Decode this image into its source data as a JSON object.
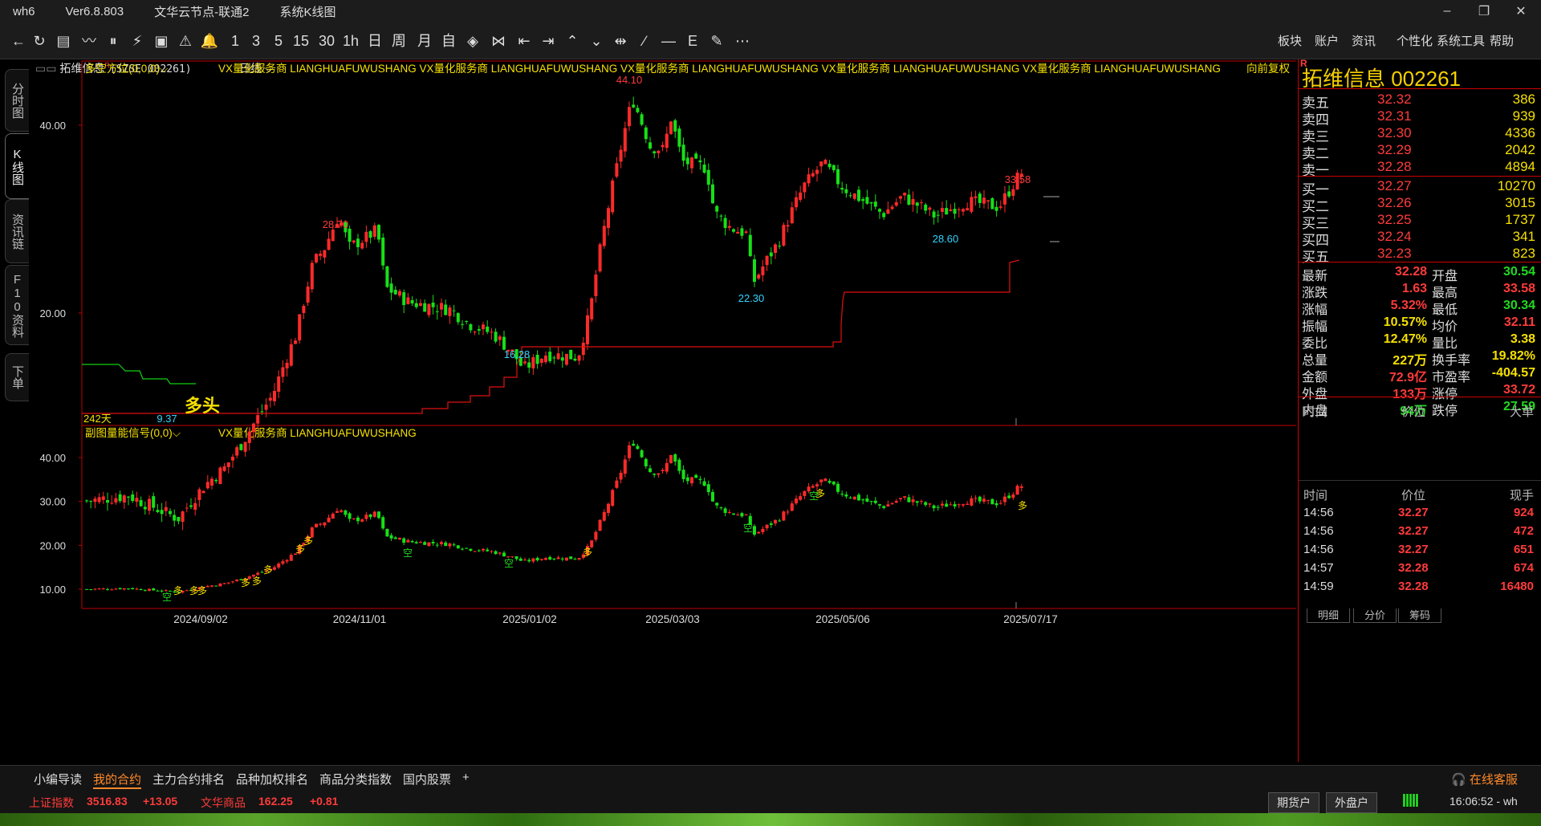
{
  "window": {
    "app": "wh6",
    "version": "Ver6.8.803",
    "server": "文华云节点-联通2",
    "view": "系统K线图",
    "min": "–",
    "restore": "❐",
    "close": "✕"
  },
  "toolbar": {
    "buttons": [
      "←",
      "↻",
      "▤",
      "〰",
      "⏸",
      "⚡",
      "▣",
      "⚠",
      "🔔",
      "1",
      "3",
      "5",
      "15",
      "30",
      "1h",
      "日",
      "周",
      "月",
      "自",
      "◈",
      "⋈",
      "⇤",
      "⇥",
      "⌃",
      "⌄",
      "⇹",
      "∕",
      "—",
      "E",
      "✎",
      "⋯"
    ],
    "menus": [
      "板块",
      "账户",
      "资讯",
      "个性化",
      "系统工具",
      "帮助"
    ]
  },
  "left_tabs": [
    {
      "label": "分时图",
      "active": false
    },
    {
      "label": "K线图",
      "active": true
    },
    {
      "label": "资讯链",
      "active": false
    },
    {
      "label": "F10资料",
      "active": false
    },
    {
      "label": "下单",
      "active": false
    }
  ],
  "chart_header": {
    "stock": "拓维信息",
    "superscript": "R",
    "code": "(SZSE 002261)",
    "period": "日线"
  },
  "main_panel": {
    "indicator_label": "多空方位(0,0,0)",
    "dropdown": "⌵",
    "watermark": "VX量化服务商  LIANGHUAFUWUSHANG  VX量化服务商  LIANGHUAFUWUSHANG  VX量化服务商  LIANGHUAFUWUSHANG  VX量化服务商  LIANGHUAFUWUSHANG  VX量化服务商  LIANGHUAFUWUSHANG",
    "adjust": "向前复权",
    "y_ticks": [
      "40.00",
      "20.00"
    ],
    "marks": {
      "high": "44.10",
      "peak1": "28.70",
      "recent_high": "33.58",
      "low1": "9.37",
      "low2": "16.28",
      "low3": "22.30",
      "low4": "28.60",
      "days": "242天",
      "signal": "多头"
    }
  },
  "sub_panel": {
    "indicator_label": "副图量能信号(0,0)",
    "watermark": "VX量化服务商  LIANGHUAFUWUSHANG",
    "y_ticks": [
      "40.00",
      "30.00",
      "20.00",
      "10.00"
    ],
    "signals_long": "多",
    "signals_short": "空"
  },
  "x_axis": [
    "2024/09/02",
    "2024/11/01",
    "2025/01/02",
    "2025/03/03",
    "2025/05/06",
    "2025/07/17"
  ],
  "quote": {
    "name": "拓维信息",
    "code": "002261",
    "r_badge": "R",
    "asks": [
      {
        "label": "卖五",
        "price": "32.32",
        "vol": "386"
      },
      {
        "label": "卖四",
        "price": "32.31",
        "vol": "939"
      },
      {
        "label": "卖三",
        "price": "32.30",
        "vol": "4336"
      },
      {
        "label": "卖二",
        "price": "32.29",
        "vol": "2042"
      },
      {
        "label": "卖一",
        "price": "32.28",
        "vol": "4894"
      }
    ],
    "bids": [
      {
        "label": "买一",
        "price": "32.27",
        "vol": "10270"
      },
      {
        "label": "买二",
        "price": "32.26",
        "vol": "3015"
      },
      {
        "label": "买三",
        "price": "32.25",
        "vol": "1737"
      },
      {
        "label": "买四",
        "price": "32.24",
        "vol": "341"
      },
      {
        "label": "买五",
        "price": "32.23",
        "vol": "823"
      }
    ],
    "stats": [
      {
        "l1": "最新",
        "v1": "32.28",
        "c1": "#ff3b3b",
        "l2": "开盘",
        "v2": "30.54",
        "c2": "#22d922"
      },
      {
        "l1": "涨跌",
        "v1": "1.63",
        "c1": "#ff3b3b",
        "l2": "最高",
        "v2": "33.58",
        "c2": "#ff3b3b"
      },
      {
        "l1": "涨幅",
        "v1": "5.32%",
        "c1": "#ff3b3b",
        "l2": "最低",
        "v2": "30.34",
        "c2": "#22d922"
      },
      {
        "l1": "振幅",
        "v1": "10.57%",
        "c1": "#f5e000",
        "l2": "均价",
        "v2": "32.11",
        "c2": "#ff3b3b"
      },
      {
        "l1": "委比",
        "v1": "12.47%",
        "c1": "#f5e000",
        "l2": "量比",
        "v2": "3.38",
        "c2": "#f5e000"
      },
      {
        "l1": "总量",
        "v1": "227万",
        "c1": "#f5e000",
        "l2": "换手率",
        "v2": "19.82%",
        "c2": "#f5e000"
      },
      {
        "l1": "金额",
        "v1": "72.9亿",
        "c1": "#ff3b3b",
        "l2": "市盈率",
        "v2": "-404.57",
        "c2": "#f5e000"
      },
      {
        "l1": "外盘",
        "v1": "133万",
        "c1": "#ff3b3b",
        "l2": "涨停",
        "v2": "33.72",
        "c2": "#ff3b3b"
      },
      {
        "l1": "内盘",
        "v1": "94万",
        "c1": "#22d922",
        "l2": "跌停",
        "v2": "27.59",
        "c2": "#22d922"
      }
    ],
    "tick_header1": [
      "时间",
      "价位",
      "大单"
    ],
    "tick_header2": [
      "时间",
      "价位",
      "现手"
    ],
    "ticks": [
      {
        "time": "14:56",
        "price": "32.27",
        "vol": "924"
      },
      {
        "time": "14:56",
        "price": "32.27",
        "vol": "472"
      },
      {
        "time": "14:56",
        "price": "32.27",
        "vol": "651"
      },
      {
        "time": "14:57",
        "price": "32.28",
        "vol": "674"
      },
      {
        "time": "14:59",
        "price": "32.28",
        "vol": "16480"
      }
    ],
    "bottom_tabs": [
      "明细",
      "分价",
      "筹码"
    ]
  },
  "bottom_tabs": [
    "小编导读",
    "我的合约",
    "主力合约排名",
    "品种加权排名",
    "商品分类指数",
    "国内股票",
    "+"
  ],
  "service": "在线客服",
  "status": {
    "idx1_name": "上证指数",
    "idx1_val": "3516.83",
    "idx1_chg": "+13.05",
    "idx2_name": "文华商品",
    "idx2_val": "162.25",
    "idx2_chg": "+0.81",
    "btn1": "期货户",
    "btn2": "外盘户",
    "clock": "16:06:52 - wh"
  },
  "colors": {
    "up": "#ff2a2a",
    "down": "#17e017",
    "label": "#f5e000",
    "axis": "#c00000"
  },
  "chart_data": {
    "type": "candlestick",
    "title": "拓维信息 (SZSE 002261) 日线",
    "x": [
      "2024/09/02",
      "2024/11/01",
      "2025/01/02",
      "2025/03/03",
      "2025/05/06",
      "2025/07/17"
    ],
    "anchors": [
      {
        "label": "9.37",
        "value": 9.37
      },
      {
        "label": "28.70",
        "value": 28.7
      },
      {
        "label": "16.28",
        "value": 16.28
      },
      {
        "label": "44.10",
        "value": 44.1
      },
      {
        "label": "22.30",
        "value": 22.3
      },
      {
        "label": "28.60",
        "value": 28.6
      },
      {
        "label": "33.58",
        "value": 33.58
      }
    ],
    "ylim_main": [
      8,
      46
    ],
    "ylim_sub": [
      7,
      46
    ]
  }
}
